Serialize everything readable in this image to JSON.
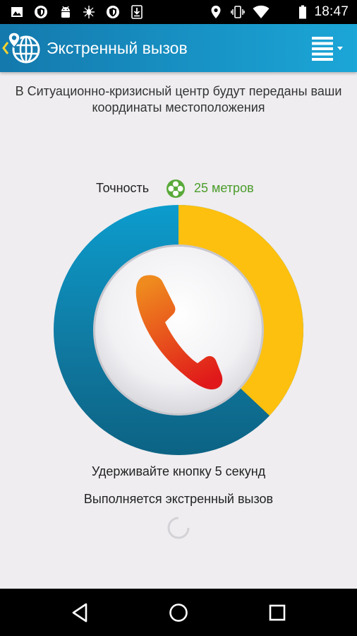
{
  "status_bar": {
    "time": "18:47",
    "left_icons": [
      "gallery-icon",
      "vpn-shield-icon",
      "android-icon",
      "bug-icon",
      "vpn-shield-icon",
      "download-icon"
    ],
    "right_icons": [
      "location-icon",
      "vibrate-icon",
      "wifi-icon",
      "battery-icon"
    ]
  },
  "app_bar": {
    "title": "Экстренный вызов",
    "accent_color": "#1ba6d7"
  },
  "main": {
    "info_text": "В Ситуационно-кризисный центр будут переданы ваши координаты местоположения",
    "accuracy_label": "Точность",
    "accuracy_value": "25 метров",
    "accuracy_color": "#4a9d2a",
    "hold_instruction": "Удерживайте кнопку 5 секунд",
    "call_status": "Выполняется экстренный вызов",
    "hold_progress_fraction": 0.37,
    "progress_color": "#fdc00f",
    "ring_color": "#10779e"
  },
  "nav_bar": {
    "icons": [
      "back-icon",
      "home-icon",
      "recents-icon"
    ]
  }
}
